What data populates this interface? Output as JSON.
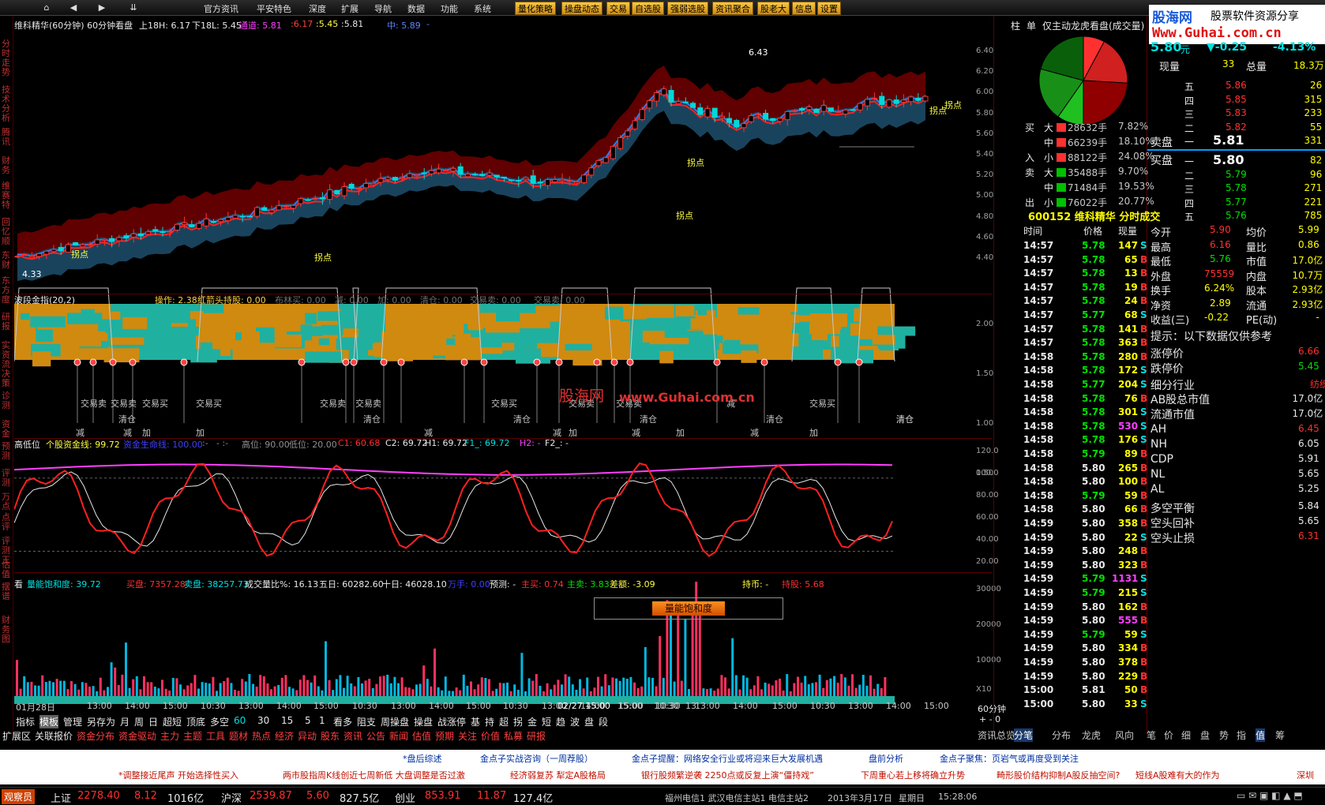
{
  "colors": {
    "up": "#ff3030",
    "down": "#00e0e0",
    "bg": "#000000",
    "accent": "#ffd040",
    "grid": "#5a0000"
  },
  "menubar": {
    "nav_icons": [
      "home-icon",
      "back-icon",
      "forward-icon",
      "collapse-icon"
    ],
    "items": [
      "官方资讯",
      "平安特色",
      "深度",
      "扩展",
      "导航",
      "数据",
      "功能",
      "系统"
    ],
    "buttons": [
      "量化策略",
      "操盘动态",
      "交易",
      "自选股",
      "强弱选股",
      "资讯聚合",
      "股老大",
      "信息",
      "设置"
    ]
  },
  "logo": {
    "cn": "股海网",
    "slogan": "股票软件资源分享",
    "url": "Www.Guhai.com.cn"
  },
  "left_tabs": [
    "分时走势",
    "技术分析",
    "腾讯",
    "财务",
    "维赛特",
    "回忆顺",
    "东财",
    "东方度",
    "研报",
    "实资流",
    "决策",
    "诊测",
    "资金",
    "预测",
    "评测",
    "万点",
    "点评",
    "评测王",
    "估值",
    "摆谱",
    "财务图"
  ],
  "chart_header": {
    "title": "维科精华(60分钟) 60分钟看盘",
    "upper": "上18H: 6.17",
    "lower": "下18L: 5.45",
    "channel": "通道: 5.81",
    "v1": ":6.17",
    ":v2": "",
    "v2": ":5.45",
    "v3": ":5.81",
    "mid": "中: 5.89",
    "mid2": "-"
  },
  "ind1": {
    "name": "波段金指(20,2)",
    "op": "操作: 2.38",
    "hold": "红箭头持股: 0.00",
    "buy_lbl": "布林买: 0.00",
    "dec": "减: 0.00",
    "add": "加: 0.00",
    "clear": "清仓: 0.00",
    "tsell": "交易卖: 0.00",
    "tsell2": "交易卖: 0.00"
  },
  "ind1_labels": [
    {
      "t": "交易卖",
      "c": "#c8c8c8"
    },
    {
      "t": "交易卖",
      "c": "#c8c8c8"
    },
    {
      "t": "交易买",
      "c": "#c8c8c8"
    },
    {
      "t": "交易买",
      "c": "#c8c8c8"
    },
    {
      "t": "交易卖",
      "c": "#c8c8c8"
    },
    {
      "t": "交易卖",
      "c": "#c8c8c8"
    },
    {
      "t": "交易买",
      "c": "#c8c8c8"
    },
    {
      "t": "交易卖",
      "c": "#c8c8c8"
    },
    {
      "t": "交易卖",
      "c": "#c8c8c8"
    },
    {
      "t": "交易买",
      "c": "#c8c8c8"
    },
    {
      "t": "清仓",
      "c": "#c8c8c8"
    },
    {
      "t": "清仓",
      "c": "#c8c8c8"
    },
    {
      "t": "清仓",
      "c": "#c8c8c8"
    },
    {
      "t": "清仓",
      "c": "#c8c8c8"
    },
    {
      "t": "清仓",
      "c": "#c8c8c8"
    },
    {
      "t": "清仓",
      "c": "#c8c8c8"
    },
    {
      "t": "清仓",
      "c": "#c8c8c8"
    },
    {
      "t": "减",
      "c": "#c8c8c8"
    },
    {
      "t": "减",
      "c": "#c8c8c8"
    },
    {
      "t": "加",
      "c": "#c8c8c8"
    },
    {
      "t": "加",
      "c": "#c8c8c8"
    },
    {
      "t": "减",
      "c": "#c8c8c8"
    },
    {
      "t": "减",
      "c": "#c8c8c8"
    },
    {
      "t": "加",
      "c": "#c8c8c8"
    },
    {
      "t": "减",
      "c": "#c8c8c8"
    },
    {
      "t": "加",
      "c": "#c8c8c8"
    },
    {
      "t": "减",
      "c": "#c8c8c8"
    },
    {
      "t": "减",
      "c": "#c8c8c8"
    },
    {
      "t": "加",
      "c": "#c8c8c8"
    }
  ],
  "watermark": {
    "cn": "股海网",
    "url": "www.Guhai.com.cn"
  },
  "ind2": {
    "name": "高低位",
    "a": "个股资金线: 99.72",
    "b": "资金生命线: 100.00",
    "c": ":-",
    "d": "- :-",
    "e": "高位: 90.00",
    "f": "低位: 20.00",
    "g": "C1: 60.68",
    "h": "C2: 69.72",
    "i": "H1: 69.72",
    "j": "F1_: 69.72",
    "k": "H2: -",
    "l": "F2_: -"
  },
  "ind3": {
    "name": "看",
    "a": "量能饱和度: 39.72",
    "b": "买盘: 7357.28",
    "c": "卖盘: 38257.73",
    "d": "成交量比%: 16.13",
    "e": "五日: 60282.60",
    "f": "十日: 46028.10",
    "g": "万手: 0.00",
    "h": "预测: -",
    "i": "主买: 0.74",
    "j": "主卖: 3.83",
    "k": "差额: -3.09",
    "l": "持币: -",
    "m": "持股: 5.68",
    "box": "量能饱和度"
  },
  "y_axis": {
    "price": [
      "6.40",
      "6.20",
      "6.00",
      "5.80",
      "5.60",
      "5.40",
      "5.20",
      "5.00",
      "4.80",
      "4.60",
      "4.40"
    ],
    "ind1": [
      "2.00",
      "1.50",
      "1.00",
      "0.50"
    ],
    "ind2": [
      "120.0",
      "100.0",
      "80.00",
      "60.00",
      "40.00",
      "20.00"
    ],
    "vol": [
      "30000",
      "20000",
      "10000"
    ],
    "unit": "X10"
  },
  "chart_notes": {
    "high": "6.43",
    "low": "4.33",
    "g1": "拐点",
    "g2": "拐点",
    "g3": "拐点",
    "g4": "拐点",
    "g5": "拐点",
    "g6": "拐点"
  },
  "x_axis": {
    "labels": [
      "01月28日",
      "13:00",
      "14:00",
      "15:00",
      "10:30",
      "13:00",
      "14:00",
      "15:00",
      "10:30",
      "13:00",
      "14:00",
      "15:00",
      "10:30",
      "13:00",
      "14:00",
      "15:00",
      "10:30",
      "13:",
      "02/27 15:00",
      "15:00",
      "10:30",
      "13:00",
      "14:00",
      "15:00",
      "10:30",
      "13:00",
      "14:00",
      "15:00"
    ],
    "period": "60分钟",
    "zoom": "+ - 0"
  },
  "bottom_tabs": [
    "指标",
    "模板",
    "管理",
    "另存为",
    "月",
    "周",
    "日",
    "超短",
    "顶底",
    "多空",
    "60",
    "30",
    "15",
    "5",
    "1",
    "看多",
    "阻支",
    "周操盘",
    "操盘",
    "战涨停",
    "基",
    "持",
    "超",
    "拐",
    "金",
    "短",
    "趋",
    "波",
    "盘",
    "段"
  ],
  "bottom_tabs2": [
    "扩展区",
    "关联报价",
    "资金分布",
    "资金驱动",
    "主力",
    "主题",
    "工具",
    "题材",
    "热点",
    "经济",
    "异动",
    "股东",
    "资讯",
    "公告",
    "新闻",
    "估值",
    "预期",
    "关注",
    "价值",
    "私募",
    "研报"
  ],
  "right_tabs": [
    "资讯总览",
    "分笔",
    "分布",
    "龙虎",
    "风向",
    "笔",
    "价",
    "细",
    "盘",
    "势",
    "指",
    "值",
    "筹"
  ],
  "top_tabs": [
    "柱",
    "单",
    "仅主动",
    "龙虎看盘(成交量)"
  ],
  "flow": [
    {
      "side": "买",
      "size": "大",
      "vol": "28632手",
      "pct": "7.82%",
      "c": "#ff3030"
    },
    {
      "side": "",
      "size": "中",
      "vol": "66239手",
      "pct": "18.10%",
      "c": "#ff3030"
    },
    {
      "side": "入",
      "size": "小",
      "vol": "88122手",
      "pct": "24.08%",
      "c": "#ff3030"
    },
    {
      "side": "卖",
      "size": "大",
      "vol": "35488手",
      "pct": "9.70%",
      "c": "#00c000"
    },
    {
      "side": "",
      "size": "中",
      "vol": "71484手",
      "pct": "19.53%",
      "c": "#00c000"
    },
    {
      "side": "出",
      "size": "小",
      "vol": "76022手",
      "pct": "20.77%",
      "c": "#00c000"
    }
  ],
  "stock": {
    "code_name": "600152 维科精华 分时成交",
    "price": "5.80",
    "unit": "元",
    "change": "-0.25",
    "change_pct": "-4.13%",
    "now_lbl": "现量",
    "now": "33",
    "total_lbl": "总量",
    "total": "18.3万"
  },
  "ticks_hdr": {
    "time": "时间",
    "price": "价格",
    "vol": "现量"
  },
  "ticks": [
    [
      "14:57",
      "5.78",
      "147",
      "S"
    ],
    [
      "14:57",
      "5.78",
      "65",
      "B"
    ],
    [
      "14:57",
      "5.78",
      "13",
      "B"
    ],
    [
      "14:57",
      "5.78",
      "19",
      "B"
    ],
    [
      "14:57",
      "5.78",
      "24",
      "B"
    ],
    [
      "14:57",
      "5.77",
      "68",
      "S"
    ],
    [
      "14:57",
      "5.78",
      "141",
      "B"
    ],
    [
      "14:57",
      "5.78",
      "363",
      "B"
    ],
    [
      "14:58",
      "5.78",
      "280",
      "B"
    ],
    [
      "14:58",
      "5.78",
      "172",
      "S"
    ],
    [
      "14:58",
      "5.77",
      "204",
      "S"
    ],
    [
      "14:58",
      "5.78",
      "76",
      "B"
    ],
    [
      "14:58",
      "5.78",
      "301",
      "S"
    ],
    [
      "14:58",
      "5.78",
      "530",
      "S"
    ],
    [
      "14:58",
      "5.78",
      "176",
      "S"
    ],
    [
      "14:58",
      "5.79",
      "89",
      "B"
    ],
    [
      "14:58",
      "5.80",
      "265",
      "B"
    ],
    [
      "14:58",
      "5.80",
      "100",
      "B"
    ],
    [
      "14:58",
      "5.79",
      "59",
      "B"
    ],
    [
      "14:58",
      "5.80",
      "66",
      "B"
    ],
    [
      "14:59",
      "5.80",
      "358",
      "B"
    ],
    [
      "14:59",
      "5.80",
      "22",
      "S"
    ],
    [
      "14:59",
      "5.80",
      "248",
      "B"
    ],
    [
      "14:59",
      "5.80",
      "323",
      "B"
    ],
    [
      "14:59",
      "5.79",
      "1131",
      "S"
    ],
    [
      "14:59",
      "5.79",
      "215",
      "S"
    ],
    [
      "14:59",
      "5.80",
      "162",
      "B"
    ],
    [
      "14:59",
      "5.80",
      "555",
      "B"
    ],
    [
      "14:59",
      "5.79",
      "59",
      "S"
    ],
    [
      "14:59",
      "5.80",
      "334",
      "B"
    ],
    [
      "14:59",
      "5.80",
      "378",
      "B"
    ],
    [
      "14:59",
      "5.80",
      "229",
      "B"
    ],
    [
      "15:00",
      "5.81",
      "50",
      "B"
    ],
    [
      "15:00",
      "5.80",
      "33",
      "S"
    ]
  ],
  "asks": [
    [
      "五",
      "5.86",
      "26"
    ],
    [
      "四",
      "5.85",
      "315"
    ],
    [
      "三",
      "5.83",
      "233"
    ],
    [
      "二",
      "5.82",
      "55"
    ],
    [
      "一",
      "5.81",
      "331"
    ]
  ],
  "bids": [
    [
      "一",
      "5.80",
      "82"
    ],
    [
      "二",
      "5.79",
      "96"
    ],
    [
      "三",
      "5.78",
      "271"
    ],
    [
      "四",
      "5.77",
      "221"
    ],
    [
      "五",
      "5.76",
      "785"
    ]
  ],
  "ask_lbl": "卖盘",
  "bid_lbl": "买盘",
  "stats": [
    [
      "今开",
      "5.90",
      "均价",
      "5.99"
    ],
    [
      "最高",
      "6.16",
      "量比",
      "0.86"
    ],
    [
      "最低",
      "5.76",
      "市值",
      "17.0亿"
    ],
    [
      "外盘",
      "75559",
      "内盘",
      "10.7万"
    ],
    [
      "换手",
      "6.24%",
      "股本",
      "2.93亿"
    ],
    [
      "净资",
      "2.89",
      "流通",
      "2.93亿"
    ],
    [
      "收益(三)",
      "-0.22",
      "PE(动)",
      "-"
    ]
  ],
  "tip": "提示：以下数据仅供参考",
  "extra": [
    [
      "涨停价",
      "6.66",
      "#ff3030"
    ],
    [
      "跌停价",
      "5.45",
      "#00e000"
    ],
    [
      "细分行业",
      "纺织",
      "#ff3030"
    ],
    [
      "AB股总市值",
      "17.0亿",
      "#e8e8e8"
    ],
    [
      "流通市值",
      "17.0亿",
      "#e8e8e8"
    ],
    [
      "AH",
      "6.45",
      "#ff3030"
    ],
    [
      "NH",
      "6.05",
      "#e8e8e8"
    ],
    [
      "CDP",
      "5.91",
      "#e8e8e8"
    ],
    [
      "NL",
      "5.65",
      "#e8e8e8"
    ],
    [
      "AL",
      "5.25",
      "#e8e8e8"
    ],
    [
      "多空平衡",
      "5.84",
      "#e8e8e8"
    ],
    [
      "空头回补",
      "5.65",
      "#e8e8e8"
    ],
    [
      "空头止损",
      "6.31",
      "#ff3030"
    ]
  ],
  "ticker": {
    "row1": [
      "*盘后综述",
      "金点子实战咨询（一周荐股）",
      "金点子提醒：网络安全行业或将迎来巨大发展机遇",
      "盘前分析",
      "金点子聚焦：页岩气或再度受到关注"
    ],
    "row2": [
      "*调整接近尾声  开始选择性买入",
      "两市股指周K线创近七周新低  大盘调整是否过激",
      "经济弱复苏  犁定A股格局",
      "银行股频繁逆袭  2250点或反复上演“僵持戏”",
      "下周重心若上移将确立升势",
      "畸形股价结构抑制A股反抽空间?",
      "短线A股难有大的作为",
      "深圳"
    ]
  },
  "status": {
    "user": "观察员",
    "sh_lbl": "上证",
    "sh": "2278.40",
    "sh_chg": "8.12",
    "sh_amt": "1016亿",
    "hs_lbl": "沪深",
    "hs": "2539.87",
    "hs_chg": "5.60",
    "hs_amt": "827.5亿",
    "cy_lbl": "创业",
    "cy": "853.91",
    "cy_chg": "11.87",
    "cy_amt": "127.4亿",
    "servers": "福州电信1  武汉电信主站1  电信主站2",
    "date": "2013年3月17日",
    "weekday": "星期日",
    "time": "15:28:06"
  }
}
